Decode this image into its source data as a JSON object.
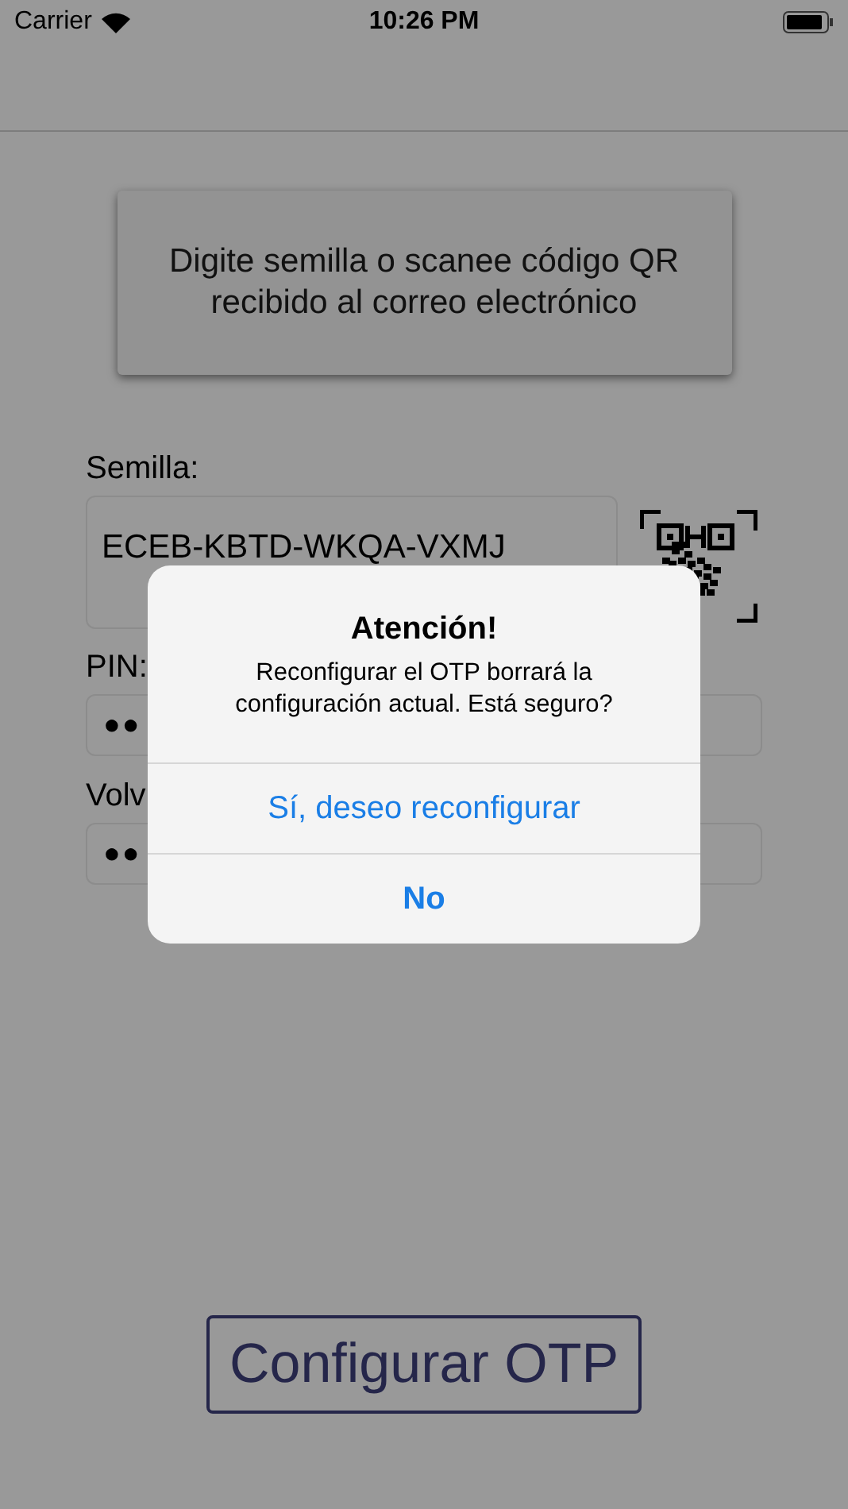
{
  "status_bar": {
    "carrier": "Carrier",
    "time": "10:26 PM"
  },
  "instructions": "Digite semilla o scanee código QR recibido al correo electrónico",
  "seed": {
    "label": "Semilla:",
    "value": "ECEB-KBTD-WKQA-VXMJ"
  },
  "pin": {
    "label": "PIN:",
    "value": "●●"
  },
  "pin_repeat": {
    "label": "Volv",
    "value": "●●"
  },
  "submit_button": "Configurar OTP",
  "alert": {
    "title": "Atención!",
    "message": "Reconfigurar el OTP borrará la configuración actual. Está seguro?",
    "actions": [
      {
        "label": "Sí, deseo reconfigurar",
        "bold": false
      },
      {
        "label": "No",
        "bold": true
      }
    ]
  }
}
